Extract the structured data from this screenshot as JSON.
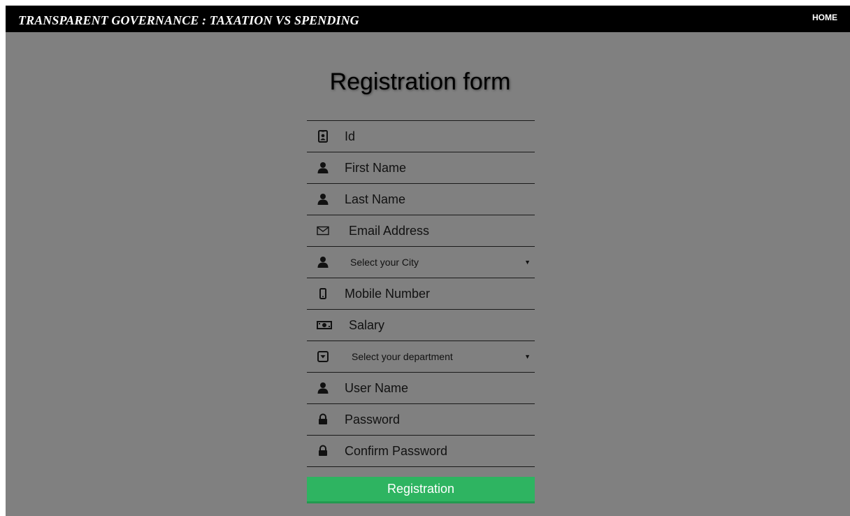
{
  "header": {
    "title": "TRANSPARENT GOVERNANCE : TAXATION VS SPENDING",
    "home_link": "HOME"
  },
  "form": {
    "title": "Registration form",
    "fields": {
      "id": {
        "placeholder": "Id",
        "icon": "id-badge-icon"
      },
      "first_name": {
        "placeholder": "First Name",
        "icon": "user-icon"
      },
      "last_name": {
        "placeholder": "Last Name",
        "icon": "user-icon"
      },
      "email": {
        "placeholder": "Email Address",
        "icon": "envelope-icon"
      },
      "city": {
        "selected": "Select your City",
        "icon": "user-icon"
      },
      "mobile": {
        "placeholder": "Mobile Number",
        "icon": "mobile-phone-icon"
      },
      "salary": {
        "placeholder": "Salary",
        "icon": "money-icon"
      },
      "department": {
        "selected": "Select your department",
        "icon": "caret-square-down-icon"
      },
      "username": {
        "placeholder": "User Name",
        "icon": "user-icon"
      },
      "password": {
        "placeholder": "Password",
        "icon": "lock-icon"
      },
      "confirm_password": {
        "placeholder": "Confirm Password",
        "icon": "lock-icon"
      }
    },
    "submit_label": "Registration"
  },
  "colors": {
    "background": "#808080",
    "topbar": "#000000",
    "submit": "#2eb461",
    "divider": "#1a1a1a"
  }
}
